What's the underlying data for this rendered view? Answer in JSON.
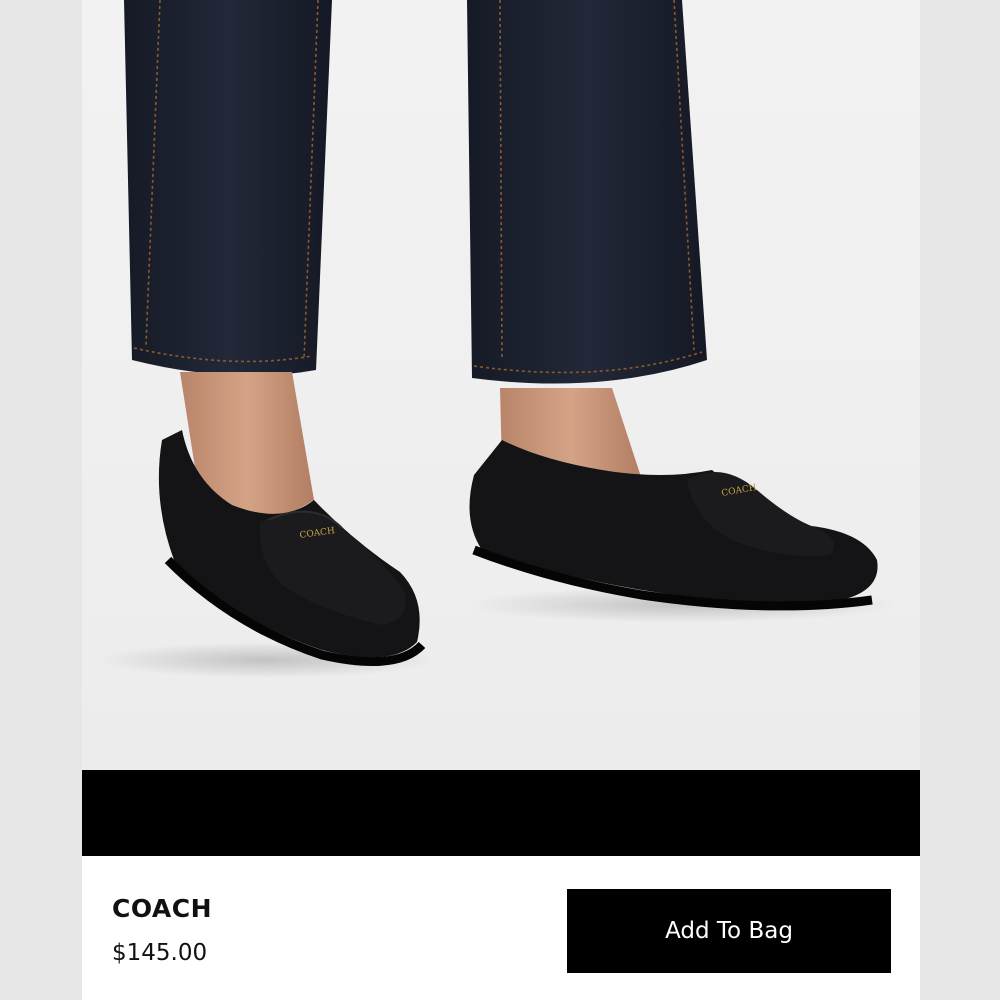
{
  "product": {
    "brand": "COACH",
    "price": "$145.00",
    "logo_text": "COACH",
    "image_subject": "black-leather-loafers"
  },
  "actions": {
    "add_to_bag_label": "Add To Bag"
  },
  "colors": {
    "button_bg": "#000000",
    "button_text": "#ffffff",
    "band": "#000000",
    "page_bg": "#ffffff",
    "shoe": "#141416",
    "denim": "#1c2130",
    "stitch": "#8a5a2c",
    "hardware": "#c8a14a"
  }
}
